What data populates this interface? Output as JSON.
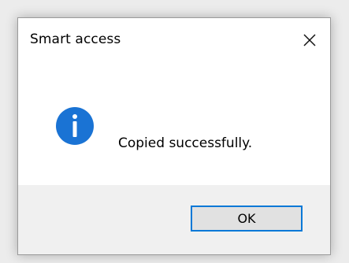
{
  "dialog": {
    "title": "Smart access",
    "message": "Copied successfully.",
    "ok_label": "OK"
  },
  "icons": {
    "close": "close-icon",
    "info": "info-icon"
  },
  "colors": {
    "info_icon": "#1a73d4",
    "ok_border": "#0078d7",
    "footer_bg": "#f0f0f0"
  }
}
